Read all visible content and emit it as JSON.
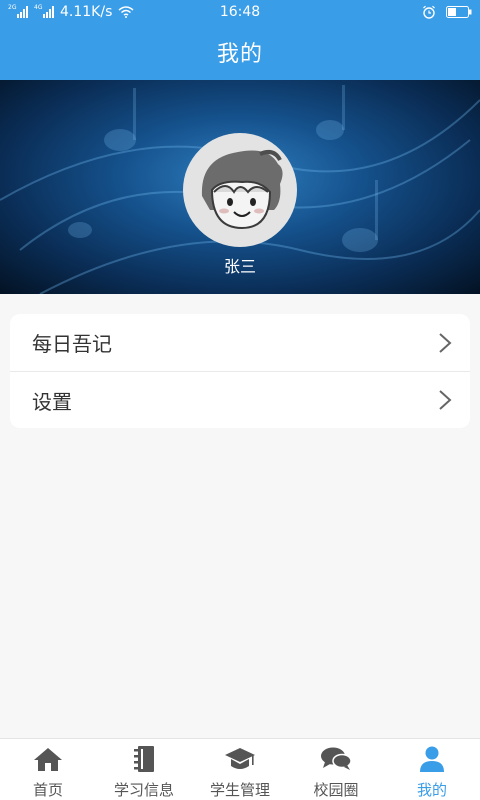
{
  "status_bar": {
    "signal1_tag": "2G",
    "signal2_tag": "4G",
    "net_speed": "4.11K/s",
    "time": "16:48"
  },
  "header": {
    "title": "我的"
  },
  "profile": {
    "username": "张三"
  },
  "menu": {
    "items": [
      {
        "label": "每日吾记",
        "icon": "chevron-right-icon"
      },
      {
        "label": "设置",
        "icon": "chevron-right-icon"
      }
    ]
  },
  "bottom_nav": {
    "items": [
      {
        "label": "首页",
        "icon": "home-icon"
      },
      {
        "label": "学习信息",
        "icon": "notebook-icon"
      },
      {
        "label": "学生管理",
        "icon": "graduation-cap-icon"
      },
      {
        "label": "校园圈",
        "icon": "chat-bubbles-icon"
      },
      {
        "label": "我的",
        "icon": "person-icon",
        "active": true
      }
    ]
  },
  "colors": {
    "primary": "#3a9de8",
    "background": "#f7f7f8",
    "nav_inactive": "#555555"
  }
}
